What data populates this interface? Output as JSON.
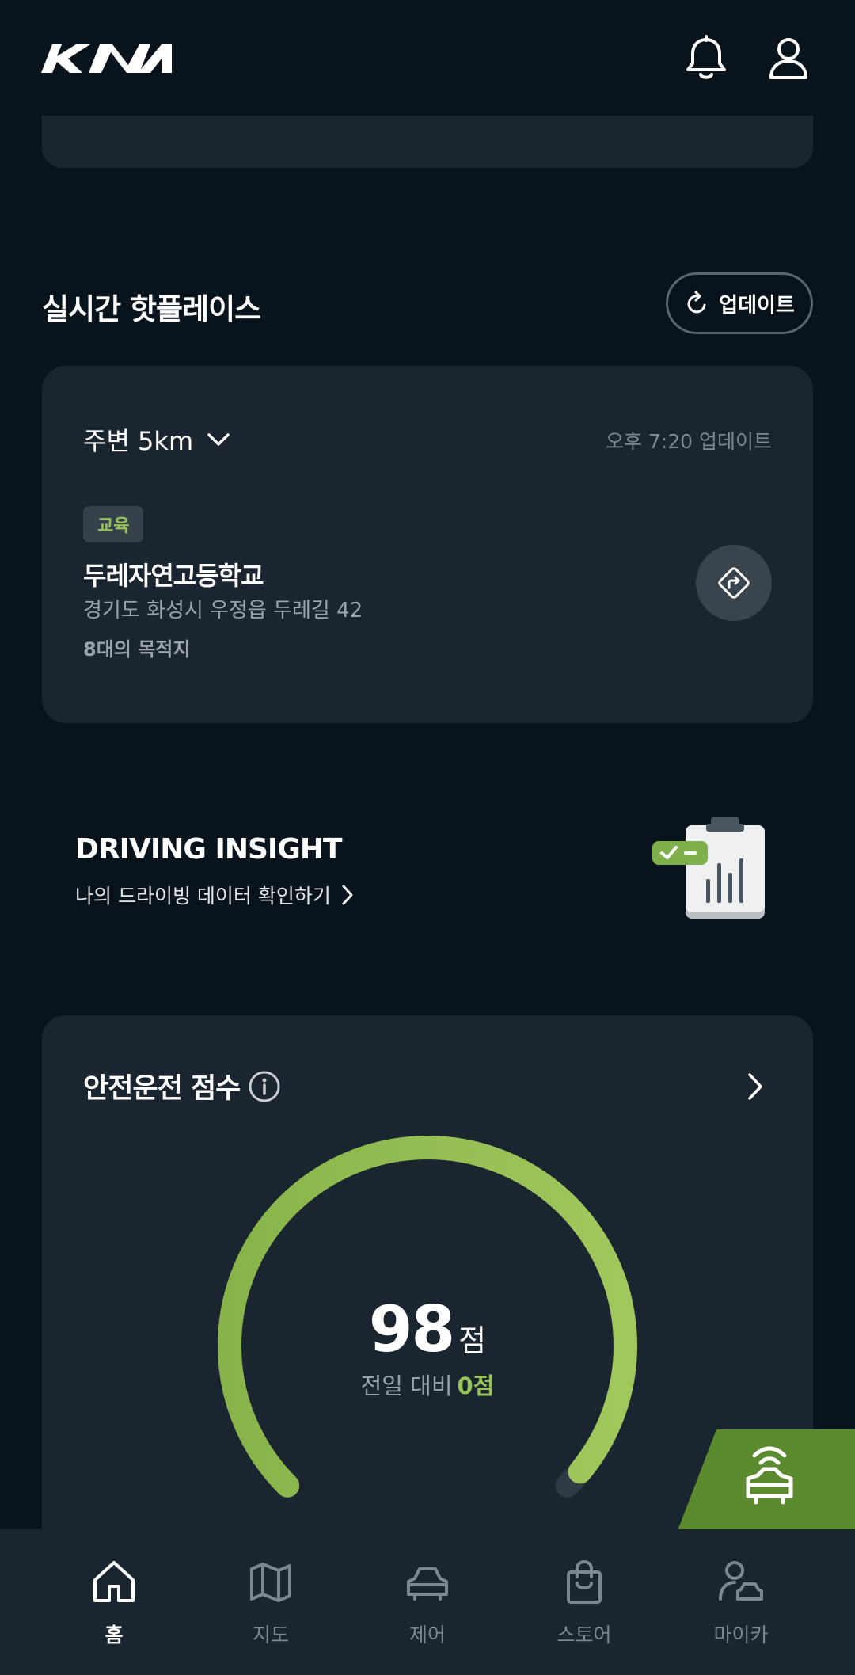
{
  "header": {
    "brand": "KIA",
    "icons": [
      "bell-icon",
      "user-icon"
    ]
  },
  "hot_place": {
    "title": "실시간 핫플레이스",
    "update_label": "업데이트",
    "radius_label": "주변 5km",
    "updated_time": "오후 7:20 업데이트",
    "tag": "교육",
    "place_name": "두레자연고등학교",
    "address": "경기도 화성시 우정읍 두레길 42",
    "count": "8대의 목적지"
  },
  "insight": {
    "title": "DRIVING INSIGHT",
    "link_label": "나의 드라이빙 데이터 확인하기"
  },
  "safety": {
    "title": "안전운전 점수",
    "score": "98",
    "unit": "점",
    "compare_label": "전일 대비",
    "compare_value": "0점",
    "gauge_fraction": 0.98
  },
  "nav": {
    "items": [
      {
        "label": "홈",
        "icon": "home-icon",
        "active": true
      },
      {
        "label": "지도",
        "icon": "map-icon",
        "active": false
      },
      {
        "label": "제어",
        "icon": "car-icon",
        "active": false
      },
      {
        "label": "스토어",
        "icon": "shopping-bag-icon",
        "active": false
      },
      {
        "label": "마이카",
        "icon": "my-car-icon",
        "active": false
      }
    ]
  },
  "colors": {
    "background": "#08131b",
    "card": "#1b2530",
    "accent": "#95c357",
    "fab": "#5b8a2f"
  }
}
